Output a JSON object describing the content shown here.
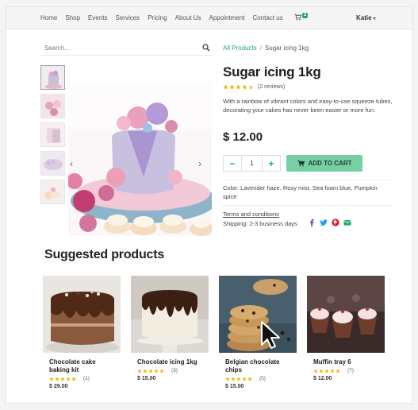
{
  "nav": {
    "items": [
      "Home",
      "Shop",
      "Events",
      "Services",
      "Pricing",
      "About Us",
      "Appointment",
      "Contact us"
    ],
    "cart_count": "2",
    "user": "Katie"
  },
  "search": {
    "placeholder": "Search..."
  },
  "breadcrumb": {
    "parent": "All Products",
    "separator": "/",
    "current": "Sugar icing 1kg"
  },
  "product": {
    "title": "Sugar icing 1kg",
    "rating": 4.5,
    "reviews": "(2 reviews)",
    "description": "With a rainbow of vibrant colors and easy-to-use squeeze tubes, decorating your cakes has never been easier or more fun.",
    "price": "$ 12.00",
    "quantity": "1",
    "add_to_cart": "ADD TO CART",
    "variants": "Color: Lavender haze, Rosy mist, Sea foam blue, Pumpkin spice",
    "terms": "Terms and conditions",
    "shipping": "Shipping: 2-3 business days"
  },
  "social_icons": [
    "facebook-icon",
    "twitter-icon",
    "pinterest-icon",
    "email-icon"
  ],
  "suggested": {
    "title": "Suggested products",
    "items": [
      {
        "name": "Chocolate cake baking kit",
        "rating": 5,
        "count": "(1)",
        "price": "$ 29.00"
      },
      {
        "name": "Chocolate icing 1kg",
        "rating": 5,
        "count": "(3)",
        "price": "$ 15.00"
      },
      {
        "name": "Belgian chocolate chips",
        "rating": 5,
        "count": "(5)",
        "price": "$ 15.00"
      },
      {
        "name": "Muffin tray 6",
        "rating": 5,
        "count": "(7)",
        "price": "$ 12.00"
      }
    ]
  },
  "colors": {
    "accent": "#21a66b",
    "button": "#76d0a4",
    "star": "#f2b517"
  }
}
